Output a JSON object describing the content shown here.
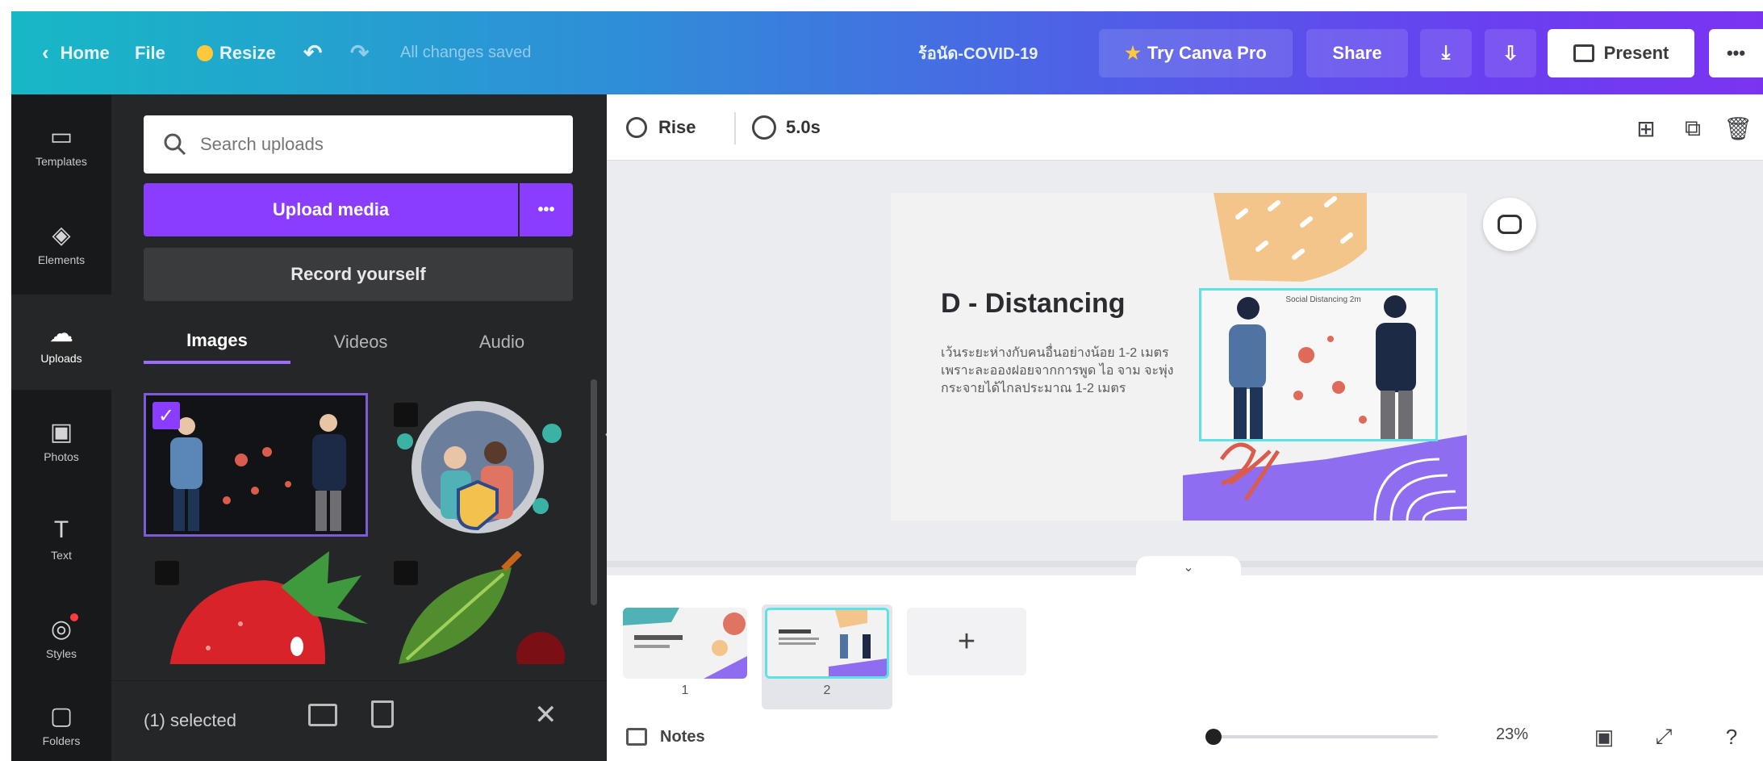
{
  "topbar": {
    "home": "Home",
    "file": "File",
    "resize": "Resize",
    "saved_status": "All changes saved",
    "doc_title": "ร้อนัด-COVID-19",
    "try_pro": "Try Canva Pro",
    "share": "Share",
    "present": "Present",
    "more": "•••"
  },
  "rail": [
    {
      "label": "Templates",
      "icon": "templates-icon"
    },
    {
      "label": "Elements",
      "icon": "elements-icon"
    },
    {
      "label": "Uploads",
      "icon": "uploads-icon"
    },
    {
      "label": "Photos",
      "icon": "photos-icon"
    },
    {
      "label": "Text",
      "icon": "text-icon"
    },
    {
      "label": "Styles",
      "icon": "styles-icon"
    },
    {
      "label": "Folders",
      "icon": "folders-icon"
    }
  ],
  "panel": {
    "search_placeholder": "Search uploads",
    "upload_media": "Upload media",
    "upload_more": "•••",
    "record": "Record yourself",
    "tabs": [
      "Images",
      "Videos",
      "Audio"
    ],
    "selected": "(1) selected"
  },
  "toolbar": {
    "animation": "Rise",
    "duration": "5.0s"
  },
  "slide": {
    "title": "D - Distancing",
    "body": "เว้นระยะห่างกับคนอื่นอย่างน้อย 1-2 เมตร เพราะละอองฝอยจากการพูด ไอ จาม จะพุ่งกระจายได้ไกลประมาณ 1-2 เมตร",
    "caption": "Social Distancing 2m"
  },
  "pages": {
    "numbers": [
      "1",
      "2"
    ],
    "add": "+"
  },
  "footer": {
    "notes": "Notes",
    "zoom_text": "23%",
    "zoom_level": 0.02
  },
  "colors": {
    "accent_purple": "#8b3dff",
    "selection": "#5de3e6",
    "panel_bg": "#252627",
    "rail_bg": "#18191b",
    "slide_bg": "#f2f2f3",
    "peach": "#f3c58a",
    "lavender": "#8f6df1"
  }
}
